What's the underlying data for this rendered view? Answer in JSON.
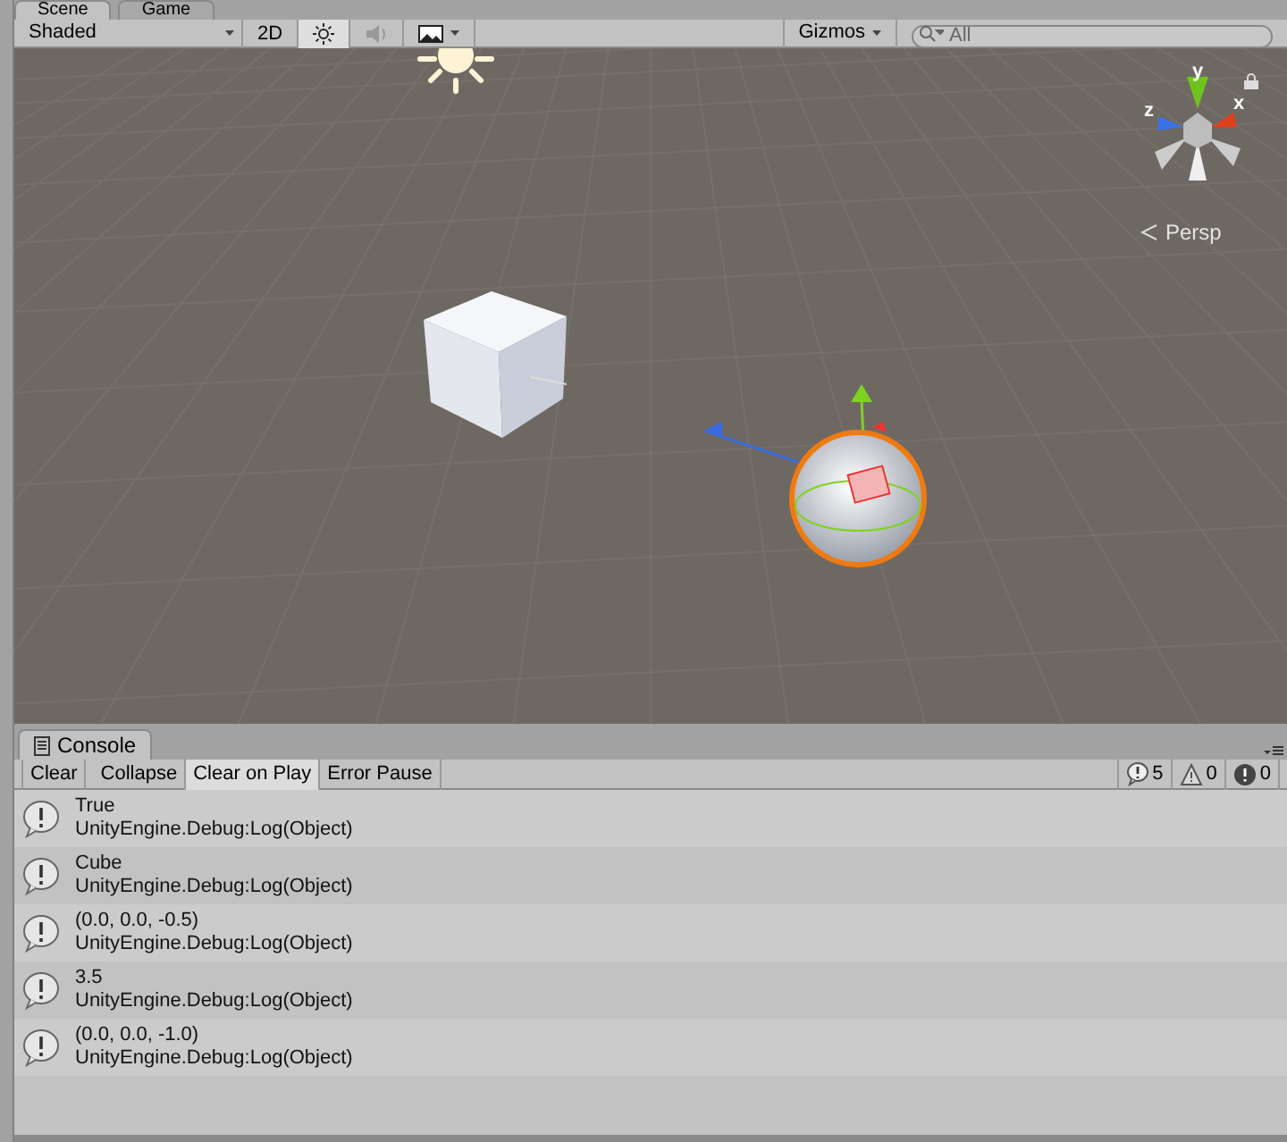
{
  "scene_tabs": [
    {
      "label": "Scene",
      "selected": true
    },
    {
      "label": "Game",
      "selected": false
    }
  ],
  "scene_toolbar": {
    "draw_mode": "Shaded",
    "mode_2d": "2D",
    "toggles": [
      {
        "kind": "lighting",
        "on": true
      },
      {
        "kind": "audio",
        "on": false
      },
      {
        "kind": "effects",
        "on": false
      }
    ],
    "gizmos": "Gizmos",
    "search": {
      "placeholder": "All"
    }
  },
  "scene_view": {
    "axis_labels": [
      "y",
      "x",
      "z"
    ],
    "projection": "Persp"
  },
  "console": {
    "tab": "Console",
    "buttons": [
      {
        "kind": "button",
        "label": "Clear"
      },
      {
        "kind": "toggle",
        "label": "Collapse",
        "on": false
      },
      {
        "kind": "toggle",
        "label": "Clear on Play",
        "on": true
      },
      {
        "kind": "toggle",
        "label": "Error Pause",
        "on": false
      }
    ],
    "counters": [
      {
        "kind": "info",
        "count": "5"
      },
      {
        "kind": "warning",
        "count": "0"
      },
      {
        "kind": "error",
        "count": "0"
      }
    ],
    "entries": [
      {
        "message": "True",
        "trace": "UnityEngine.Debug:Log(Object)"
      },
      {
        "message": "Cube",
        "trace": "UnityEngine.Debug:Log(Object)"
      },
      {
        "message": "(0.0, 0.0, -0.5)",
        "trace": "UnityEngine.Debug:Log(Object)"
      },
      {
        "message": "3.5",
        "trace": "UnityEngine.Debug:Log(Object)"
      },
      {
        "message": "(0.0, 0.0, -1.0)",
        "trace": "UnityEngine.Debug:Log(Object)"
      }
    ]
  }
}
